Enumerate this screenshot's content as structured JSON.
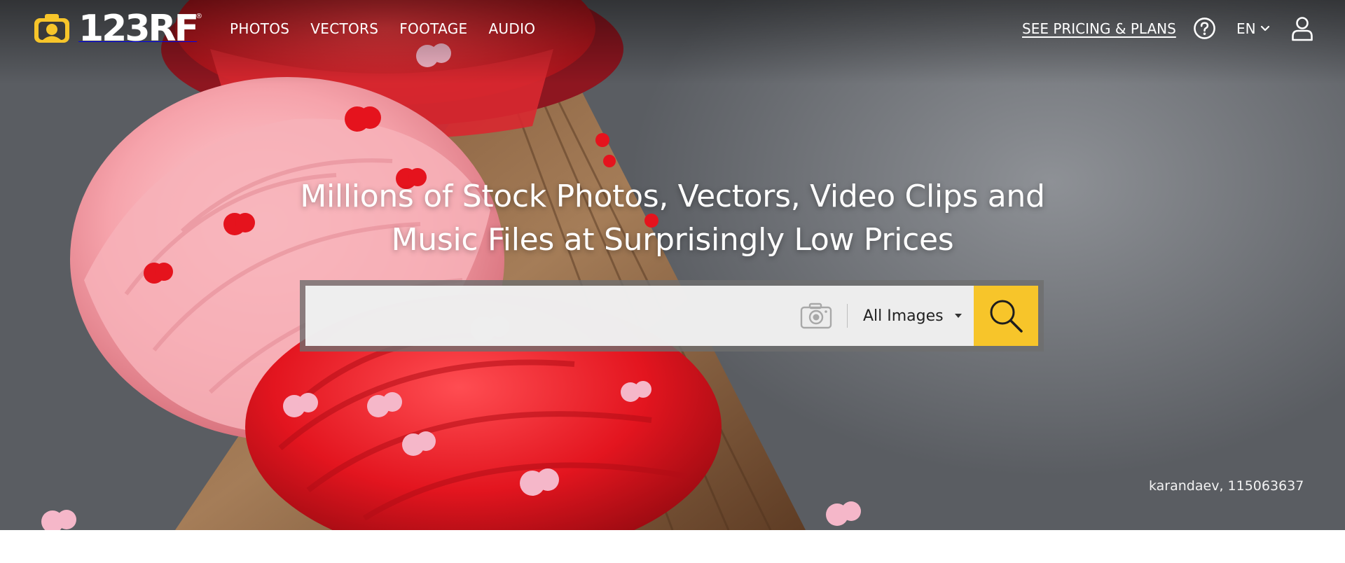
{
  "brand": {
    "name": "123RF",
    "reg_mark": "®",
    "accent": "#f7c52a"
  },
  "nav": {
    "items": [
      {
        "label": "PHOTOS"
      },
      {
        "label": "VECTORS"
      },
      {
        "label": "FOOTAGE"
      },
      {
        "label": "AUDIO"
      }
    ],
    "pricing_label": "SEE PRICING & PLANS",
    "language": "EN",
    "icons": {
      "help": "help-circle-icon",
      "user": "user-icon",
      "language_caret": "chevron-down-icon"
    }
  },
  "hero": {
    "headline": "Millions of Stock Photos, Vectors, Video Clips and Music Files at Surprisingly Low Prices",
    "credit": "karandaev, 115063637"
  },
  "search": {
    "query": "",
    "placeholder": "",
    "type_selected": "All Images",
    "icons": {
      "camera": "camera-icon",
      "submit": "search-icon"
    }
  }
}
